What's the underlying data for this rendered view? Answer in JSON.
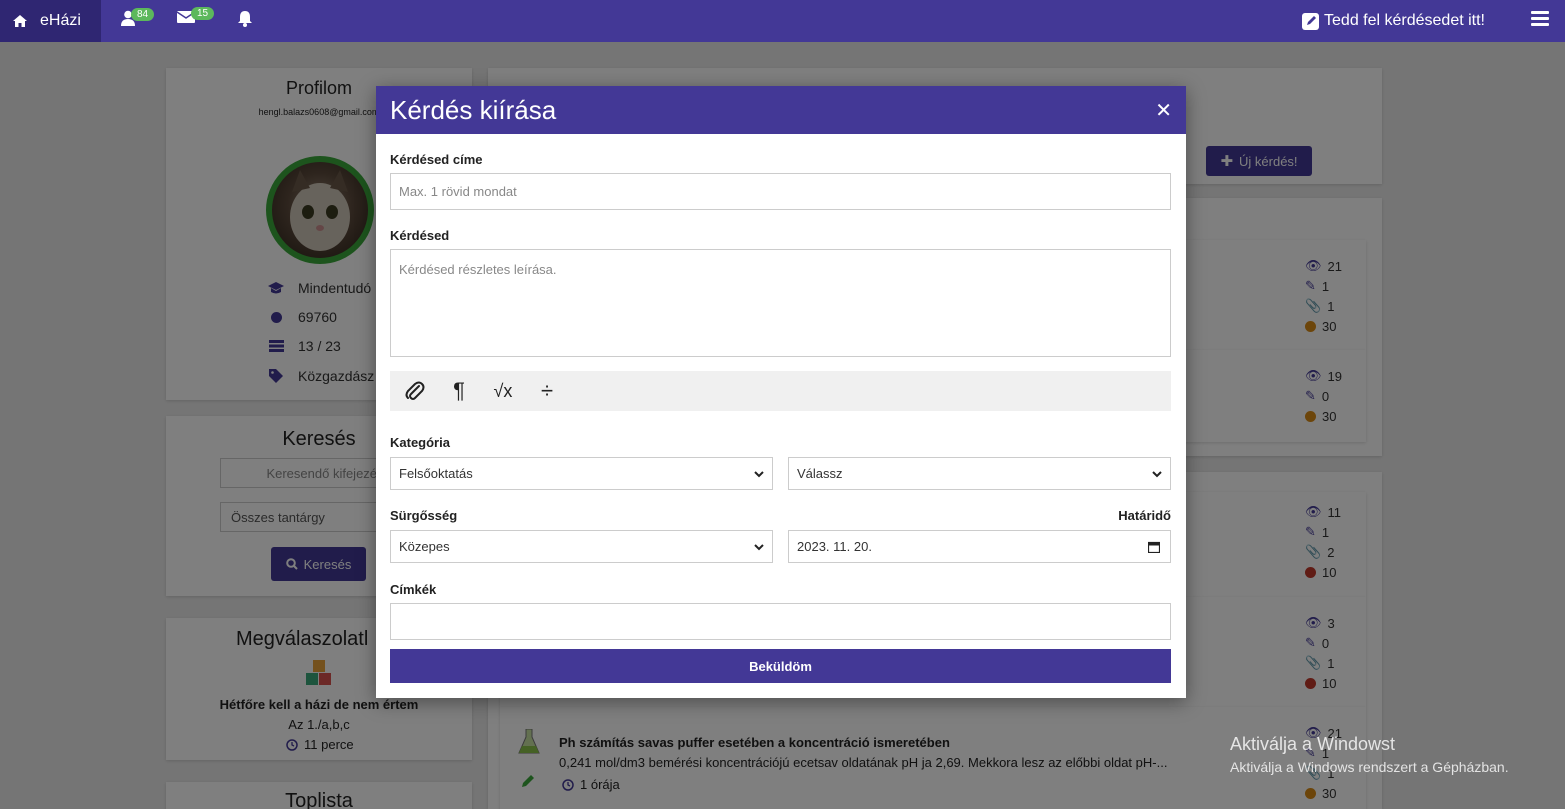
{
  "navbar": {
    "brand": "eHázi",
    "friends_count": "84",
    "messages_count": "15",
    "ask_label": "Tedd fel kérdésedet itt!"
  },
  "profile": {
    "title": "Profilom",
    "email": "hengl.balazs0608@gmail.com",
    "rank": "Mindentudó",
    "points": "69760",
    "ratio": "13 / 23",
    "specialty": "Közgazdász"
  },
  "search": {
    "title": "Keresés",
    "placeholder": "Keresendő kifejezés",
    "subject": "Összes tantárgy",
    "button": "Keresés"
  },
  "answered": {
    "title": "Megválaszolatl",
    "question": "Hétfőre kell a házi de nem értem",
    "snippet": "Az 1./a,b,c",
    "time": "11 perce"
  },
  "toplist": {
    "title": "Toplista"
  },
  "new_question_button": "Új kérdés!",
  "questions": [
    {
      "views": "21",
      "answers": "1",
      "attachments": "1",
      "points": "30",
      "color": "#d88a14"
    },
    {
      "views": "19",
      "answers": "0",
      "points": "30",
      "color": "#d88a14"
    },
    {
      "views": "11",
      "answers": "1",
      "attachments": "2",
      "points": "10",
      "color": "#c0392b"
    },
    {
      "views": "3",
      "answers": "0",
      "attachments": "1",
      "points": "10",
      "color": "#c0392b"
    },
    {
      "views": "21",
      "answers": "1",
      "attachments": "1",
      "points": "30",
      "color": "#d88a14",
      "title": "Ph számítás savas puffer esetében a koncentráció ismeretében",
      "snippet": "0,241 mol/dm3 bemérési koncentrációjú ecetsav oldatának pH ja 2,69. Mekkora lesz az előbbi oldat pH-...",
      "time": "1 órája"
    }
  ],
  "watermark": {
    "line1": "Aktiválja a Windowst",
    "line2": "Aktiválja a Windows rendszert a Gépházban."
  },
  "modal": {
    "title": "Kérdés kiírása",
    "title_label": "Kérdésed címe",
    "title_placeholder": "Max. 1 rövid mondat",
    "body_label": "Kérdésed",
    "body_placeholder": "Kérdésed részletes leírása.",
    "category_label": "Kategória",
    "category_value": "Felsőoktatás",
    "subcategory_value": "Válassz",
    "urgency_label": "Sürgősség",
    "urgency_value": "Közepes",
    "deadline_label": "Határidő",
    "deadline_value": "2023. 11. 20.",
    "tags_label": "Címkék",
    "submit": "Beküldöm"
  },
  "colors": {
    "primary": "#433896",
    "brand_dark": "#2f2672",
    "badge": "#5cb85c"
  }
}
